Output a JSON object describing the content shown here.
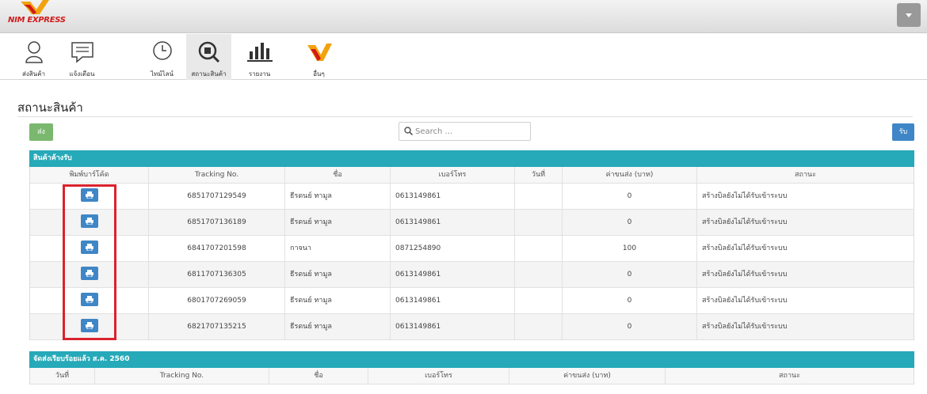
{
  "app": {
    "logo_text": "NIM EXPRESS"
  },
  "toolbar": {
    "items": [
      {
        "label": "ส่งสินค้า",
        "icon": "user-icon"
      },
      {
        "label": "แจ้งเตือน",
        "icon": "message-icon"
      },
      {
        "label": "ไทม์ไลน์",
        "icon": "clock-icon"
      },
      {
        "label": "สถานะสินค้า",
        "icon": "package-search-icon"
      },
      {
        "label": "รายงาน",
        "icon": "bar-chart-icon"
      },
      {
        "label": "อื่นๆ",
        "icon": "nim-logo-icon"
      }
    ],
    "active_index": 3
  },
  "page": {
    "title": "สถานะสินค้า"
  },
  "actions": {
    "send_label": "ส่ง",
    "receive_label": "รับ"
  },
  "search": {
    "placeholder": "Search ..."
  },
  "pending": {
    "title": "สินค้าค้างรับ",
    "columns": [
      "พิมพ์บาร์โค้ด",
      "Tracking No.",
      "ชื่อ",
      "เบอร์โทร",
      "วันที่",
      "ค่าขนส่ง (บาท)",
      "สถานะ"
    ],
    "rows": [
      {
        "tracking": "6851707129549",
        "name": "ธีรดนย์ ทามูล",
        "phone": "0613149861",
        "date": "",
        "fee": "0",
        "status": "สร้างบิลยังไม่ได้รับเข้าระบบ"
      },
      {
        "tracking": "6851707136189",
        "name": "ธีรดนย์ ทามูล",
        "phone": "0613149861",
        "date": "",
        "fee": "0",
        "status": "สร้างบิลยังไม่ได้รับเข้าระบบ"
      },
      {
        "tracking": "6841707201598",
        "name": "กาจนา",
        "phone": "0871254890",
        "date": "",
        "fee": "100",
        "status": "สร้างบิลยังไม่ได้รับเข้าระบบ"
      },
      {
        "tracking": "6811707136305",
        "name": "ธีรดนย์ ทามูล",
        "phone": "0613149861",
        "date": "",
        "fee": "0",
        "status": "สร้างบิลยังไม่ได้รับเข้าระบบ"
      },
      {
        "tracking": "6801707269059",
        "name": "ธีรดนย์ ทามูล",
        "phone": "0613149861",
        "date": "",
        "fee": "0",
        "status": "สร้างบิลยังไม่ได้รับเข้าระบบ"
      },
      {
        "tracking": "6821707135215",
        "name": "ธีรดนย์ ทามูล",
        "phone": "0613149861",
        "date": "",
        "fee": "0",
        "status": "สร้างบิลยังไม่ได้รับเข้าระบบ"
      }
    ]
  },
  "delivered": {
    "title": "จัดส่งเรียบร้อยแล้ว ส.ค. 2560",
    "columns": [
      "วันที่",
      "Tracking No.",
      "ชื่อ",
      "เบอร์โทร",
      "ค่าขนส่ง (บาท)",
      "สถานะ"
    ]
  },
  "colors": {
    "accent": "#26a9b8",
    "primary": "#3f86c6",
    "success": "#7ab86f",
    "highlight": "#d9232d",
    "brand": "#d21a1a"
  }
}
